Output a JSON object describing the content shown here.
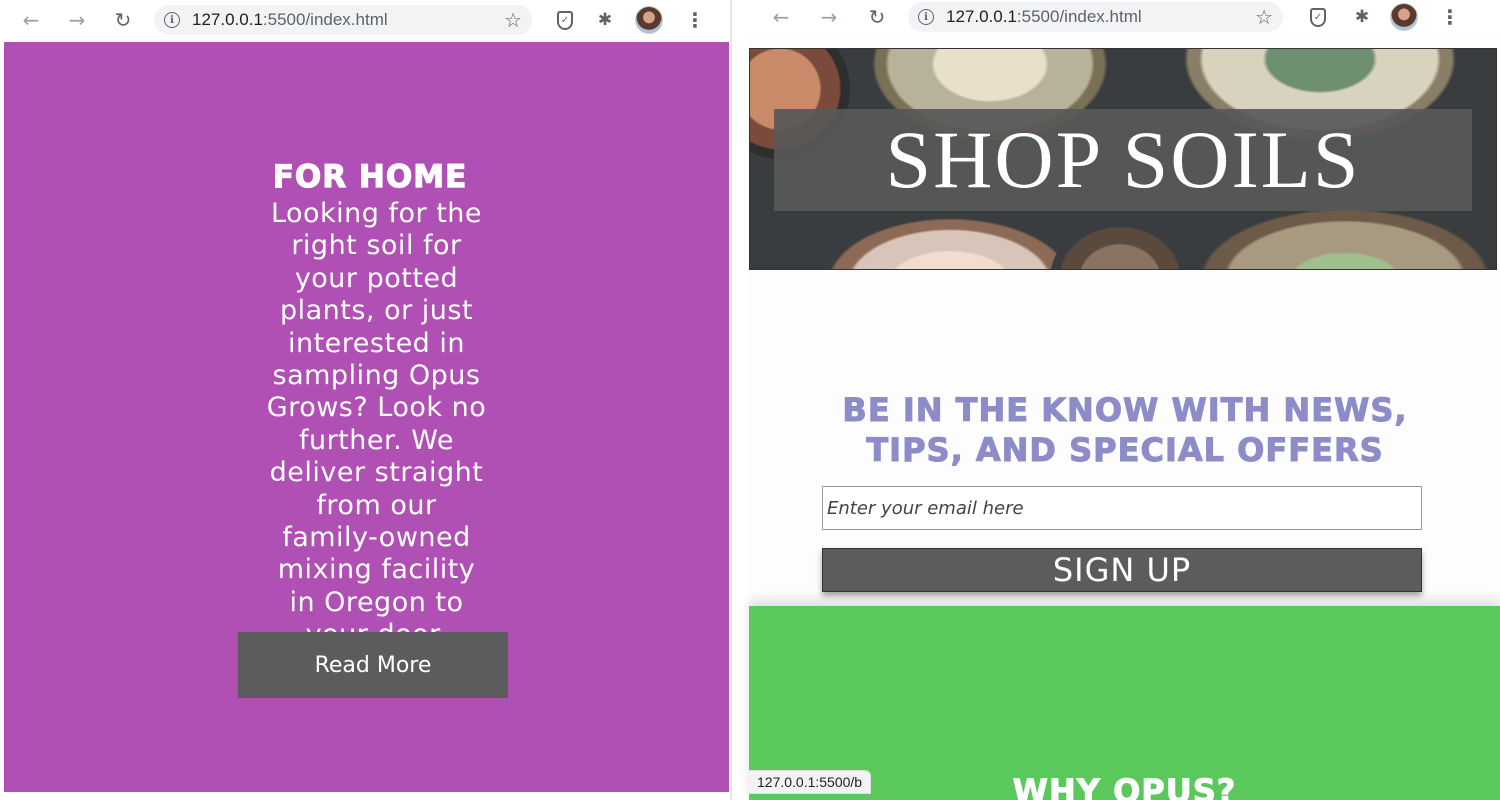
{
  "left_window": {
    "browser": {
      "url_host": "127.0.0.1",
      "url_path": ":5500/index.html",
      "icons": [
        "back-arrow-icon",
        "forward-arrow-icon",
        "reload-icon",
        "info-icon",
        "star-icon",
        "shield-icon",
        "puzzle-icon",
        "avatar",
        "kebab-menu-icon"
      ]
    },
    "page": {
      "background": "#b050b4",
      "heading": "FOR HOME",
      "body_lines": [
        "Looking for the",
        "right soil for",
        "your potted",
        "plants, or just",
        "interested in",
        "sampling Opus",
        "Grows? Look no",
        "further. We",
        "deliver straight",
        "from our",
        "family-owned",
        "mixing facility",
        "in Oregon to",
        "your door."
      ],
      "read_more_label": "Read More"
    }
  },
  "right_window": {
    "browser": {
      "url_host": "127.0.0.1",
      "url_path": ":5500/index.html"
    },
    "page": {
      "hero_title": "SHOP SOILS",
      "newsletter_heading_line1": "BE IN THE KNOW WITH NEWS,",
      "newsletter_heading_line2": "TIPS, AND SPECIAL OFFERS",
      "email_placeholder": "Enter your email here",
      "signup_label": "SIGN UP",
      "green_section_color": "#5ac85a",
      "green_section_heading": "WHY OPUS?",
      "status_url": "127.0.0.1:5500/b"
    }
  }
}
